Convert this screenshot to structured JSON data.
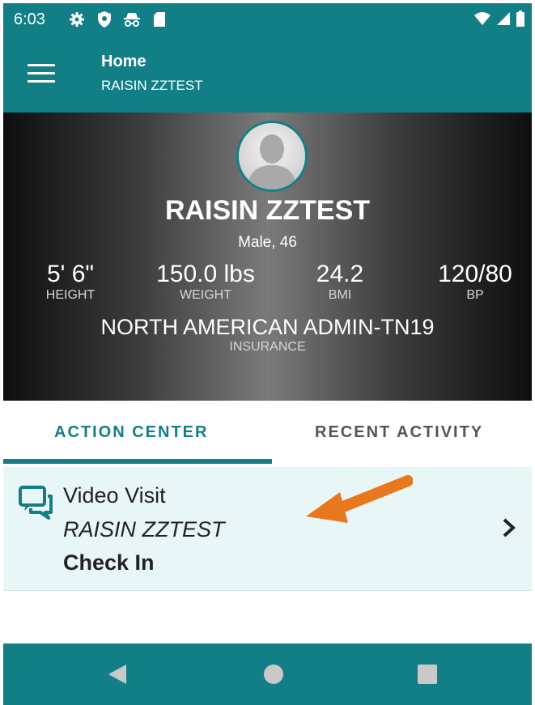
{
  "status_bar": {
    "time": "6:03",
    "icons": [
      "settings-icon",
      "shield-icon",
      "incognito-icon",
      "sd-card-icon"
    ],
    "right_icons": [
      "wifi-icon",
      "signal-icon",
      "battery-icon"
    ]
  },
  "app_bar": {
    "title": "Home",
    "subtitle": "RAISIN ZZTEST"
  },
  "profile": {
    "name": "RAISIN ZZTEST",
    "demographics": "Male, 46",
    "stats": [
      {
        "value": "5' 6\"",
        "label": "HEIGHT"
      },
      {
        "value": "150.0 lbs",
        "label": "WEIGHT"
      },
      {
        "value": "24.2",
        "label": "BMI"
      },
      {
        "value": "120/80",
        "label": "BP"
      }
    ],
    "insurance": {
      "value": "NORTH AMERICAN ADMIN-TN19",
      "label": "INSURANCE"
    }
  },
  "tabs": [
    {
      "label": "ACTION CENTER",
      "active": true
    },
    {
      "label": "RECENT ACTIVITY",
      "active": false
    }
  ],
  "action_card": {
    "icon": "chat-bubbles-icon",
    "title": "Video Visit",
    "patient": "RAISIN ZZTEST",
    "action": "Check In"
  },
  "nav": [
    "back-icon",
    "home-icon",
    "recents-icon"
  ],
  "colors": {
    "primary": "#127f87",
    "card_bg": "#e9f6f8",
    "arrow": "#e8781e"
  }
}
